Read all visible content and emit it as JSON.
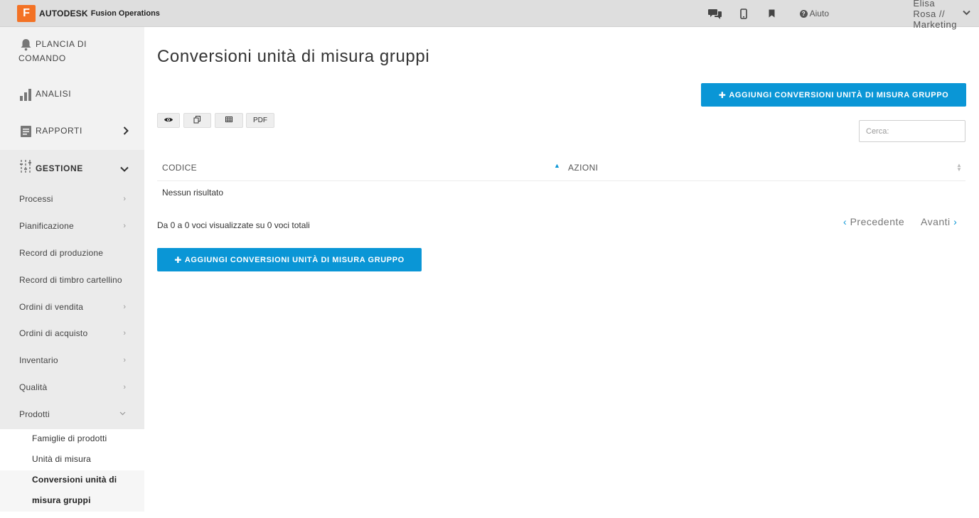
{
  "topbar": {
    "logo_letter": "F",
    "brand": "AUTODESK",
    "product": "Fusion Operations",
    "help_label": "Aiuto",
    "user_label": "Elisa Rosa // Marketing"
  },
  "sidebar": {
    "main": [
      {
        "label_line1": "PLANCIA DI",
        "label_line2": "COMANDO",
        "icon": "bell-icon"
      },
      {
        "label": "ANALISI",
        "icon": "bar-chart-icon"
      },
      {
        "label": "RAPPORTI",
        "icon": "report-icon"
      },
      {
        "label": "GESTIONE",
        "icon": "sliders-icon"
      }
    ],
    "sub_items": [
      {
        "label": "Processi"
      },
      {
        "label": "Pianificazione"
      },
      {
        "label": "Record di produzione"
      },
      {
        "label": "Record di timbro cartellino"
      },
      {
        "label": "Ordini di vendita"
      },
      {
        "label": "Ordini di acquisto"
      },
      {
        "label": "Inventario"
      },
      {
        "label": "Qualità"
      },
      {
        "label": "Prodotti"
      }
    ],
    "products_children": [
      {
        "label": "Famiglie di prodotti"
      },
      {
        "label": "Unità di misura"
      },
      {
        "label_line1": "Conversioni unità di",
        "label_line2": "misura gruppi"
      }
    ]
  },
  "main": {
    "title": "Conversioni unità di misura gruppi",
    "add_button_label": "AGGIUNGI CONVERSIONI UNITÀ DI MISURA GRUPPO",
    "toolbar": {
      "pdf_label": "PDF"
    },
    "search_placeholder": "Cerca:",
    "table": {
      "columns": [
        "CODICE",
        "AZIONI"
      ],
      "empty_message": "Nessun risultato"
    },
    "info_text": "Da 0 a 0 voci visualizzate su 0 voci totali",
    "pager": {
      "prev": "Precedente",
      "next": "Avanti"
    }
  },
  "colors": {
    "accent": "#0a96d6",
    "brand_orange": "#f37225",
    "sidebar_bg": "#f2f2f2",
    "topbar_bg": "#dedede"
  }
}
